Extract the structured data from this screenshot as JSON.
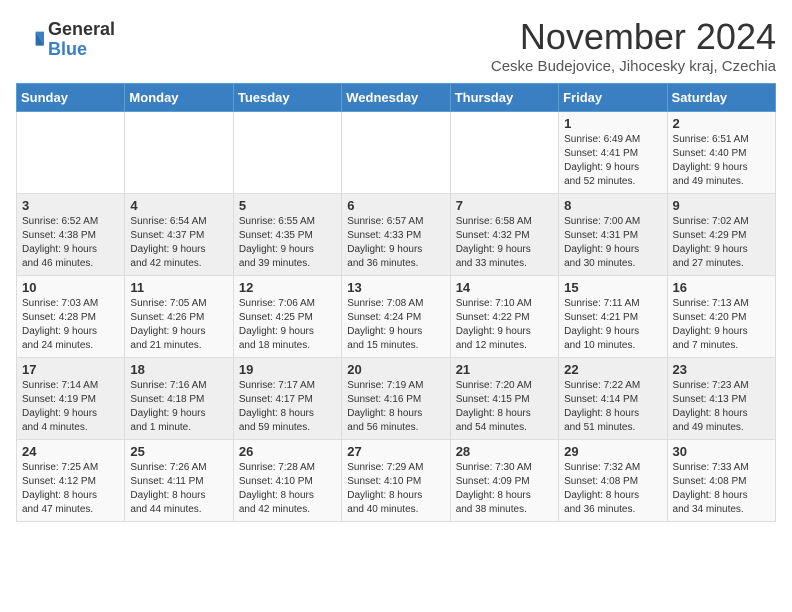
{
  "logo": {
    "general": "General",
    "blue": "Blue"
  },
  "title": "November 2024",
  "subtitle": "Ceske Budejovice, Jihocesky kraj, Czechia",
  "weekdays": [
    "Sunday",
    "Monday",
    "Tuesday",
    "Wednesday",
    "Thursday",
    "Friday",
    "Saturday"
  ],
  "weeks": [
    [
      {
        "day": "",
        "info": ""
      },
      {
        "day": "",
        "info": ""
      },
      {
        "day": "",
        "info": ""
      },
      {
        "day": "",
        "info": ""
      },
      {
        "day": "",
        "info": ""
      },
      {
        "day": "1",
        "info": "Sunrise: 6:49 AM\nSunset: 4:41 PM\nDaylight: 9 hours\nand 52 minutes."
      },
      {
        "day": "2",
        "info": "Sunrise: 6:51 AM\nSunset: 4:40 PM\nDaylight: 9 hours\nand 49 minutes."
      }
    ],
    [
      {
        "day": "3",
        "info": "Sunrise: 6:52 AM\nSunset: 4:38 PM\nDaylight: 9 hours\nand 46 minutes."
      },
      {
        "day": "4",
        "info": "Sunrise: 6:54 AM\nSunset: 4:37 PM\nDaylight: 9 hours\nand 42 minutes."
      },
      {
        "day": "5",
        "info": "Sunrise: 6:55 AM\nSunset: 4:35 PM\nDaylight: 9 hours\nand 39 minutes."
      },
      {
        "day": "6",
        "info": "Sunrise: 6:57 AM\nSunset: 4:33 PM\nDaylight: 9 hours\nand 36 minutes."
      },
      {
        "day": "7",
        "info": "Sunrise: 6:58 AM\nSunset: 4:32 PM\nDaylight: 9 hours\nand 33 minutes."
      },
      {
        "day": "8",
        "info": "Sunrise: 7:00 AM\nSunset: 4:31 PM\nDaylight: 9 hours\nand 30 minutes."
      },
      {
        "day": "9",
        "info": "Sunrise: 7:02 AM\nSunset: 4:29 PM\nDaylight: 9 hours\nand 27 minutes."
      }
    ],
    [
      {
        "day": "10",
        "info": "Sunrise: 7:03 AM\nSunset: 4:28 PM\nDaylight: 9 hours\nand 24 minutes."
      },
      {
        "day": "11",
        "info": "Sunrise: 7:05 AM\nSunset: 4:26 PM\nDaylight: 9 hours\nand 21 minutes."
      },
      {
        "day": "12",
        "info": "Sunrise: 7:06 AM\nSunset: 4:25 PM\nDaylight: 9 hours\nand 18 minutes."
      },
      {
        "day": "13",
        "info": "Sunrise: 7:08 AM\nSunset: 4:24 PM\nDaylight: 9 hours\nand 15 minutes."
      },
      {
        "day": "14",
        "info": "Sunrise: 7:10 AM\nSunset: 4:22 PM\nDaylight: 9 hours\nand 12 minutes."
      },
      {
        "day": "15",
        "info": "Sunrise: 7:11 AM\nSunset: 4:21 PM\nDaylight: 9 hours\nand 10 minutes."
      },
      {
        "day": "16",
        "info": "Sunrise: 7:13 AM\nSunset: 4:20 PM\nDaylight: 9 hours\nand 7 minutes."
      }
    ],
    [
      {
        "day": "17",
        "info": "Sunrise: 7:14 AM\nSunset: 4:19 PM\nDaylight: 9 hours\nand 4 minutes."
      },
      {
        "day": "18",
        "info": "Sunrise: 7:16 AM\nSunset: 4:18 PM\nDaylight: 9 hours\nand 1 minute."
      },
      {
        "day": "19",
        "info": "Sunrise: 7:17 AM\nSunset: 4:17 PM\nDaylight: 8 hours\nand 59 minutes."
      },
      {
        "day": "20",
        "info": "Sunrise: 7:19 AM\nSunset: 4:16 PM\nDaylight: 8 hours\nand 56 minutes."
      },
      {
        "day": "21",
        "info": "Sunrise: 7:20 AM\nSunset: 4:15 PM\nDaylight: 8 hours\nand 54 minutes."
      },
      {
        "day": "22",
        "info": "Sunrise: 7:22 AM\nSunset: 4:14 PM\nDaylight: 8 hours\nand 51 minutes."
      },
      {
        "day": "23",
        "info": "Sunrise: 7:23 AM\nSunset: 4:13 PM\nDaylight: 8 hours\nand 49 minutes."
      }
    ],
    [
      {
        "day": "24",
        "info": "Sunrise: 7:25 AM\nSunset: 4:12 PM\nDaylight: 8 hours\nand 47 minutes."
      },
      {
        "day": "25",
        "info": "Sunrise: 7:26 AM\nSunset: 4:11 PM\nDaylight: 8 hours\nand 44 minutes."
      },
      {
        "day": "26",
        "info": "Sunrise: 7:28 AM\nSunset: 4:10 PM\nDaylight: 8 hours\nand 42 minutes."
      },
      {
        "day": "27",
        "info": "Sunrise: 7:29 AM\nSunset: 4:10 PM\nDaylight: 8 hours\nand 40 minutes."
      },
      {
        "day": "28",
        "info": "Sunrise: 7:30 AM\nSunset: 4:09 PM\nDaylight: 8 hours\nand 38 minutes."
      },
      {
        "day": "29",
        "info": "Sunrise: 7:32 AM\nSunset: 4:08 PM\nDaylight: 8 hours\nand 36 minutes."
      },
      {
        "day": "30",
        "info": "Sunrise: 7:33 AM\nSunset: 4:08 PM\nDaylight: 8 hours\nand 34 minutes."
      }
    ]
  ]
}
